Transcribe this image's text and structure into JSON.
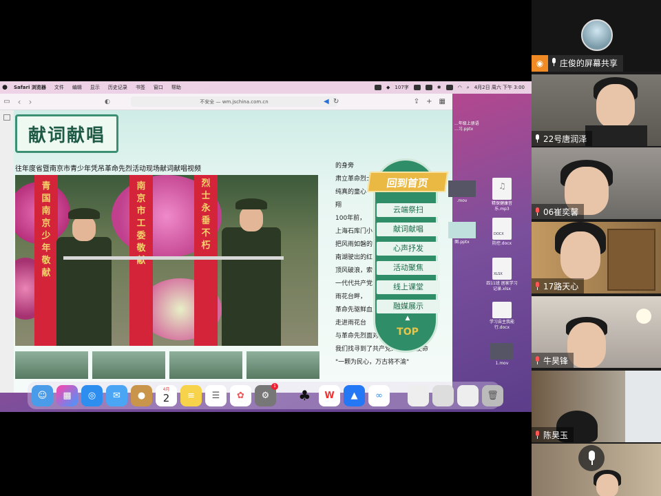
{
  "menubar": {
    "app": "Safari 浏览器",
    "items": [
      "文件",
      "编辑",
      "显示",
      "历史记录",
      "书签",
      "窗口",
      "帮助"
    ],
    "battery": "107字",
    "datetime": "4月2日 周六 下午 3:00"
  },
  "browser": {
    "url": "不安全 — wm.jschina.com.cn"
  },
  "page": {
    "logo": "献词献唱",
    "video_title": "往年度省暨南京市青少年凭吊革命先烈活动现场献词献唱视频",
    "banners": [
      [
        "青",
        "国",
        "南",
        "京",
        "少",
        "年",
        "敬",
        "献"
      ],
      [
        "南",
        "京",
        "市",
        "工",
        "委",
        "敬",
        "献"
      ],
      [
        "烈",
        "士",
        "永",
        "垂",
        "不",
        "朽"
      ]
    ],
    "poem": [
      "的身旁",
      "肃立革命烈士",
      "纯真的童心",
      "翔",
      "100年前，",
      "上海石库门小",
      "把风雨如磐的",
      "南湖驶出的红",
      "顶风破浪，索",
      "一代代共产党",
      "雨花台畔，",
      "革命先驱鲜血",
      "走进雨花台",
      "与革命先烈面对面",
      "我们找寻到了共产党人的初心使命",
      "\"一颗为民心，万古将不渝\""
    ]
  },
  "navpanel": {
    "home": "回到首页",
    "items": [
      "云端祭扫",
      "献词献唱",
      "心声抒发",
      "活动聚焦",
      "线上课堂",
      "融媒展示"
    ],
    "top_arrow": "▲",
    "top_label": "TOP"
  },
  "desktop": {
    "files": [
      {
        "name": "...年级上册语\n...习.pptx"
      },
      {
        "name": ".mov"
      },
      {
        "name": "精保健康音乐.mp3"
      },
      {
        "name": "图.pptx"
      },
      {
        "name": "防控.docx"
      },
      {
        "name": "四11班 居家学习记录.xlsx"
      },
      {
        "name": "学习自主我能行.docx"
      },
      {
        "name": "1.mov"
      }
    ],
    "file_tags": {
      "docx": "DOCX",
      "xlsx": "XLSX"
    }
  },
  "dock": {
    "calendar_month": "4月",
    "calendar_day": "2",
    "badge": "1"
  },
  "participants": {
    "host_label": "庄俊的屏幕共享",
    "tiles": [
      {
        "name": "22号唐润泽",
        "muted": false
      },
      {
        "name": "06崔奕馨",
        "muted": true
      },
      {
        "name": "17路天心",
        "muted": true
      },
      {
        "name": "牛昊锋",
        "muted": true
      },
      {
        "name": "陈昊玉",
        "muted": true
      },
      {
        "name": "",
        "muted": false
      }
    ]
  },
  "colors": {
    "accent_green": "#2f8d67",
    "host_orange": "#f08a24",
    "banner_red": "#d4243a",
    "home_gold": "#e9b943"
  }
}
